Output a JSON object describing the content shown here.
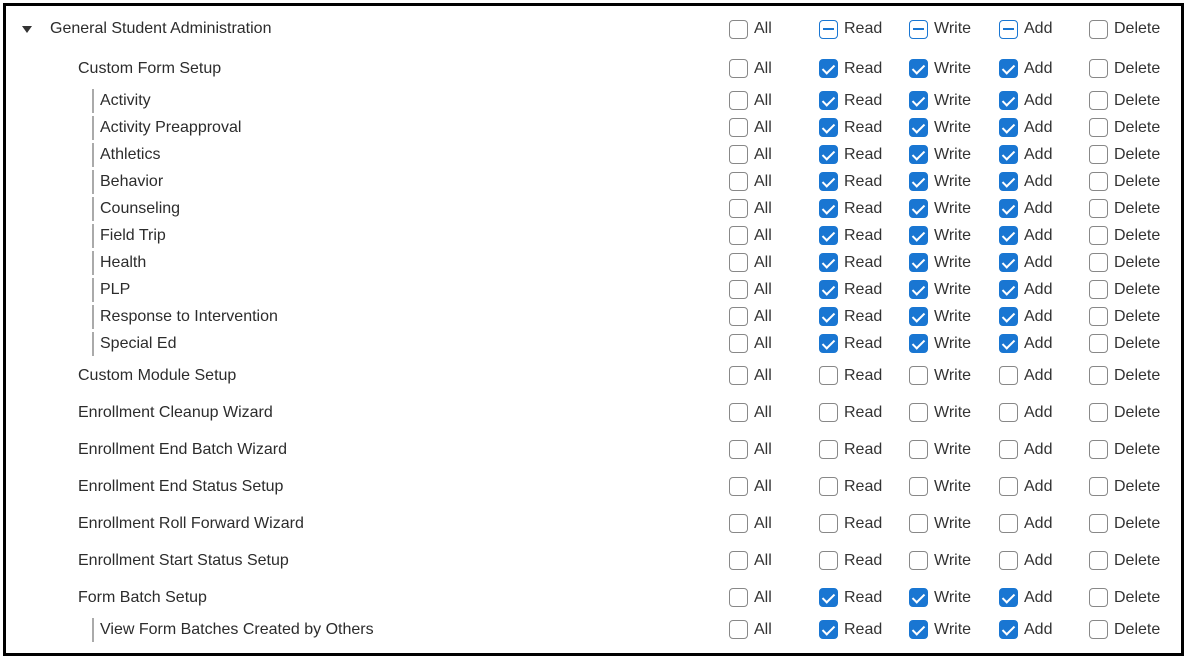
{
  "columns": {
    "all": "All",
    "read": "Read",
    "write": "Write",
    "add": "Add",
    "delete": "Delete"
  },
  "rows": [
    {
      "label": "General Student Administration",
      "indent": 0,
      "top": true,
      "perms": {
        "all": "unchecked",
        "read": "indeterminate",
        "write": "indeterminate",
        "add": "indeterminate",
        "delete": "unchecked"
      }
    },
    {
      "label": "Custom Form Setup",
      "indent": 1,
      "section": true,
      "perms": {
        "all": "unchecked",
        "read": "checked",
        "write": "checked",
        "add": "checked",
        "delete": "unchecked"
      }
    },
    {
      "label": "Activity",
      "indent": 2,
      "bar": true,
      "perms": {
        "all": "unchecked",
        "read": "checked",
        "write": "checked",
        "add": "checked",
        "delete": "unchecked"
      }
    },
    {
      "label": "Activity Preapproval",
      "indent": 2,
      "bar": true,
      "perms": {
        "all": "unchecked",
        "read": "checked",
        "write": "checked",
        "add": "checked",
        "delete": "unchecked"
      }
    },
    {
      "label": "Athletics",
      "indent": 2,
      "bar": true,
      "perms": {
        "all": "unchecked",
        "read": "checked",
        "write": "checked",
        "add": "checked",
        "delete": "unchecked"
      }
    },
    {
      "label": "Behavior",
      "indent": 2,
      "bar": true,
      "perms": {
        "all": "unchecked",
        "read": "checked",
        "write": "checked",
        "add": "checked",
        "delete": "unchecked"
      }
    },
    {
      "label": "Counseling",
      "indent": 2,
      "bar": true,
      "perms": {
        "all": "unchecked",
        "read": "checked",
        "write": "checked",
        "add": "checked",
        "delete": "unchecked"
      }
    },
    {
      "label": "Field Trip",
      "indent": 2,
      "bar": true,
      "perms": {
        "all": "unchecked",
        "read": "checked",
        "write": "checked",
        "add": "checked",
        "delete": "unchecked"
      }
    },
    {
      "label": "Health",
      "indent": 2,
      "bar": true,
      "perms": {
        "all": "unchecked",
        "read": "checked",
        "write": "checked",
        "add": "checked",
        "delete": "unchecked"
      }
    },
    {
      "label": "PLP",
      "indent": 2,
      "bar": true,
      "perms": {
        "all": "unchecked",
        "read": "checked",
        "write": "checked",
        "add": "checked",
        "delete": "unchecked"
      }
    },
    {
      "label": "Response to Intervention",
      "indent": 2,
      "bar": true,
      "perms": {
        "all": "unchecked",
        "read": "checked",
        "write": "checked",
        "add": "checked",
        "delete": "unchecked"
      }
    },
    {
      "label": "Special Ed",
      "indent": 2,
      "bar": true,
      "perms": {
        "all": "unchecked",
        "read": "checked",
        "write": "checked",
        "add": "checked",
        "delete": "unchecked"
      }
    },
    {
      "label": "Custom Module Setup",
      "indent": 1,
      "section": true,
      "perms": {
        "all": "unchecked",
        "read": "unchecked",
        "write": "unchecked",
        "add": "unchecked",
        "delete": "unchecked"
      }
    },
    {
      "label": "Enrollment Cleanup Wizard",
      "indent": 1,
      "section": true,
      "perms": {
        "all": "unchecked",
        "read": "unchecked",
        "write": "unchecked",
        "add": "unchecked",
        "delete": "unchecked"
      }
    },
    {
      "label": "Enrollment End Batch Wizard",
      "indent": 1,
      "section": true,
      "perms": {
        "all": "unchecked",
        "read": "unchecked",
        "write": "unchecked",
        "add": "unchecked",
        "delete": "unchecked"
      }
    },
    {
      "label": "Enrollment End Status Setup",
      "indent": 1,
      "section": true,
      "perms": {
        "all": "unchecked",
        "read": "unchecked",
        "write": "unchecked",
        "add": "unchecked",
        "delete": "unchecked"
      }
    },
    {
      "label": "Enrollment Roll Forward Wizard",
      "indent": 1,
      "section": true,
      "perms": {
        "all": "unchecked",
        "read": "unchecked",
        "write": "unchecked",
        "add": "unchecked",
        "delete": "unchecked"
      }
    },
    {
      "label": "Enrollment Start Status Setup",
      "indent": 1,
      "section": true,
      "perms": {
        "all": "unchecked",
        "read": "unchecked",
        "write": "unchecked",
        "add": "unchecked",
        "delete": "unchecked"
      }
    },
    {
      "label": "Form Batch Setup",
      "indent": 1,
      "section": true,
      "perms": {
        "all": "unchecked",
        "read": "checked",
        "write": "checked",
        "add": "checked",
        "delete": "unchecked"
      }
    },
    {
      "label": "View Form Batches Created by Others",
      "indent": 2,
      "bar": true,
      "perms": {
        "all": "unchecked",
        "read": "checked",
        "write": "checked",
        "add": "checked",
        "delete": "unchecked"
      }
    }
  ]
}
